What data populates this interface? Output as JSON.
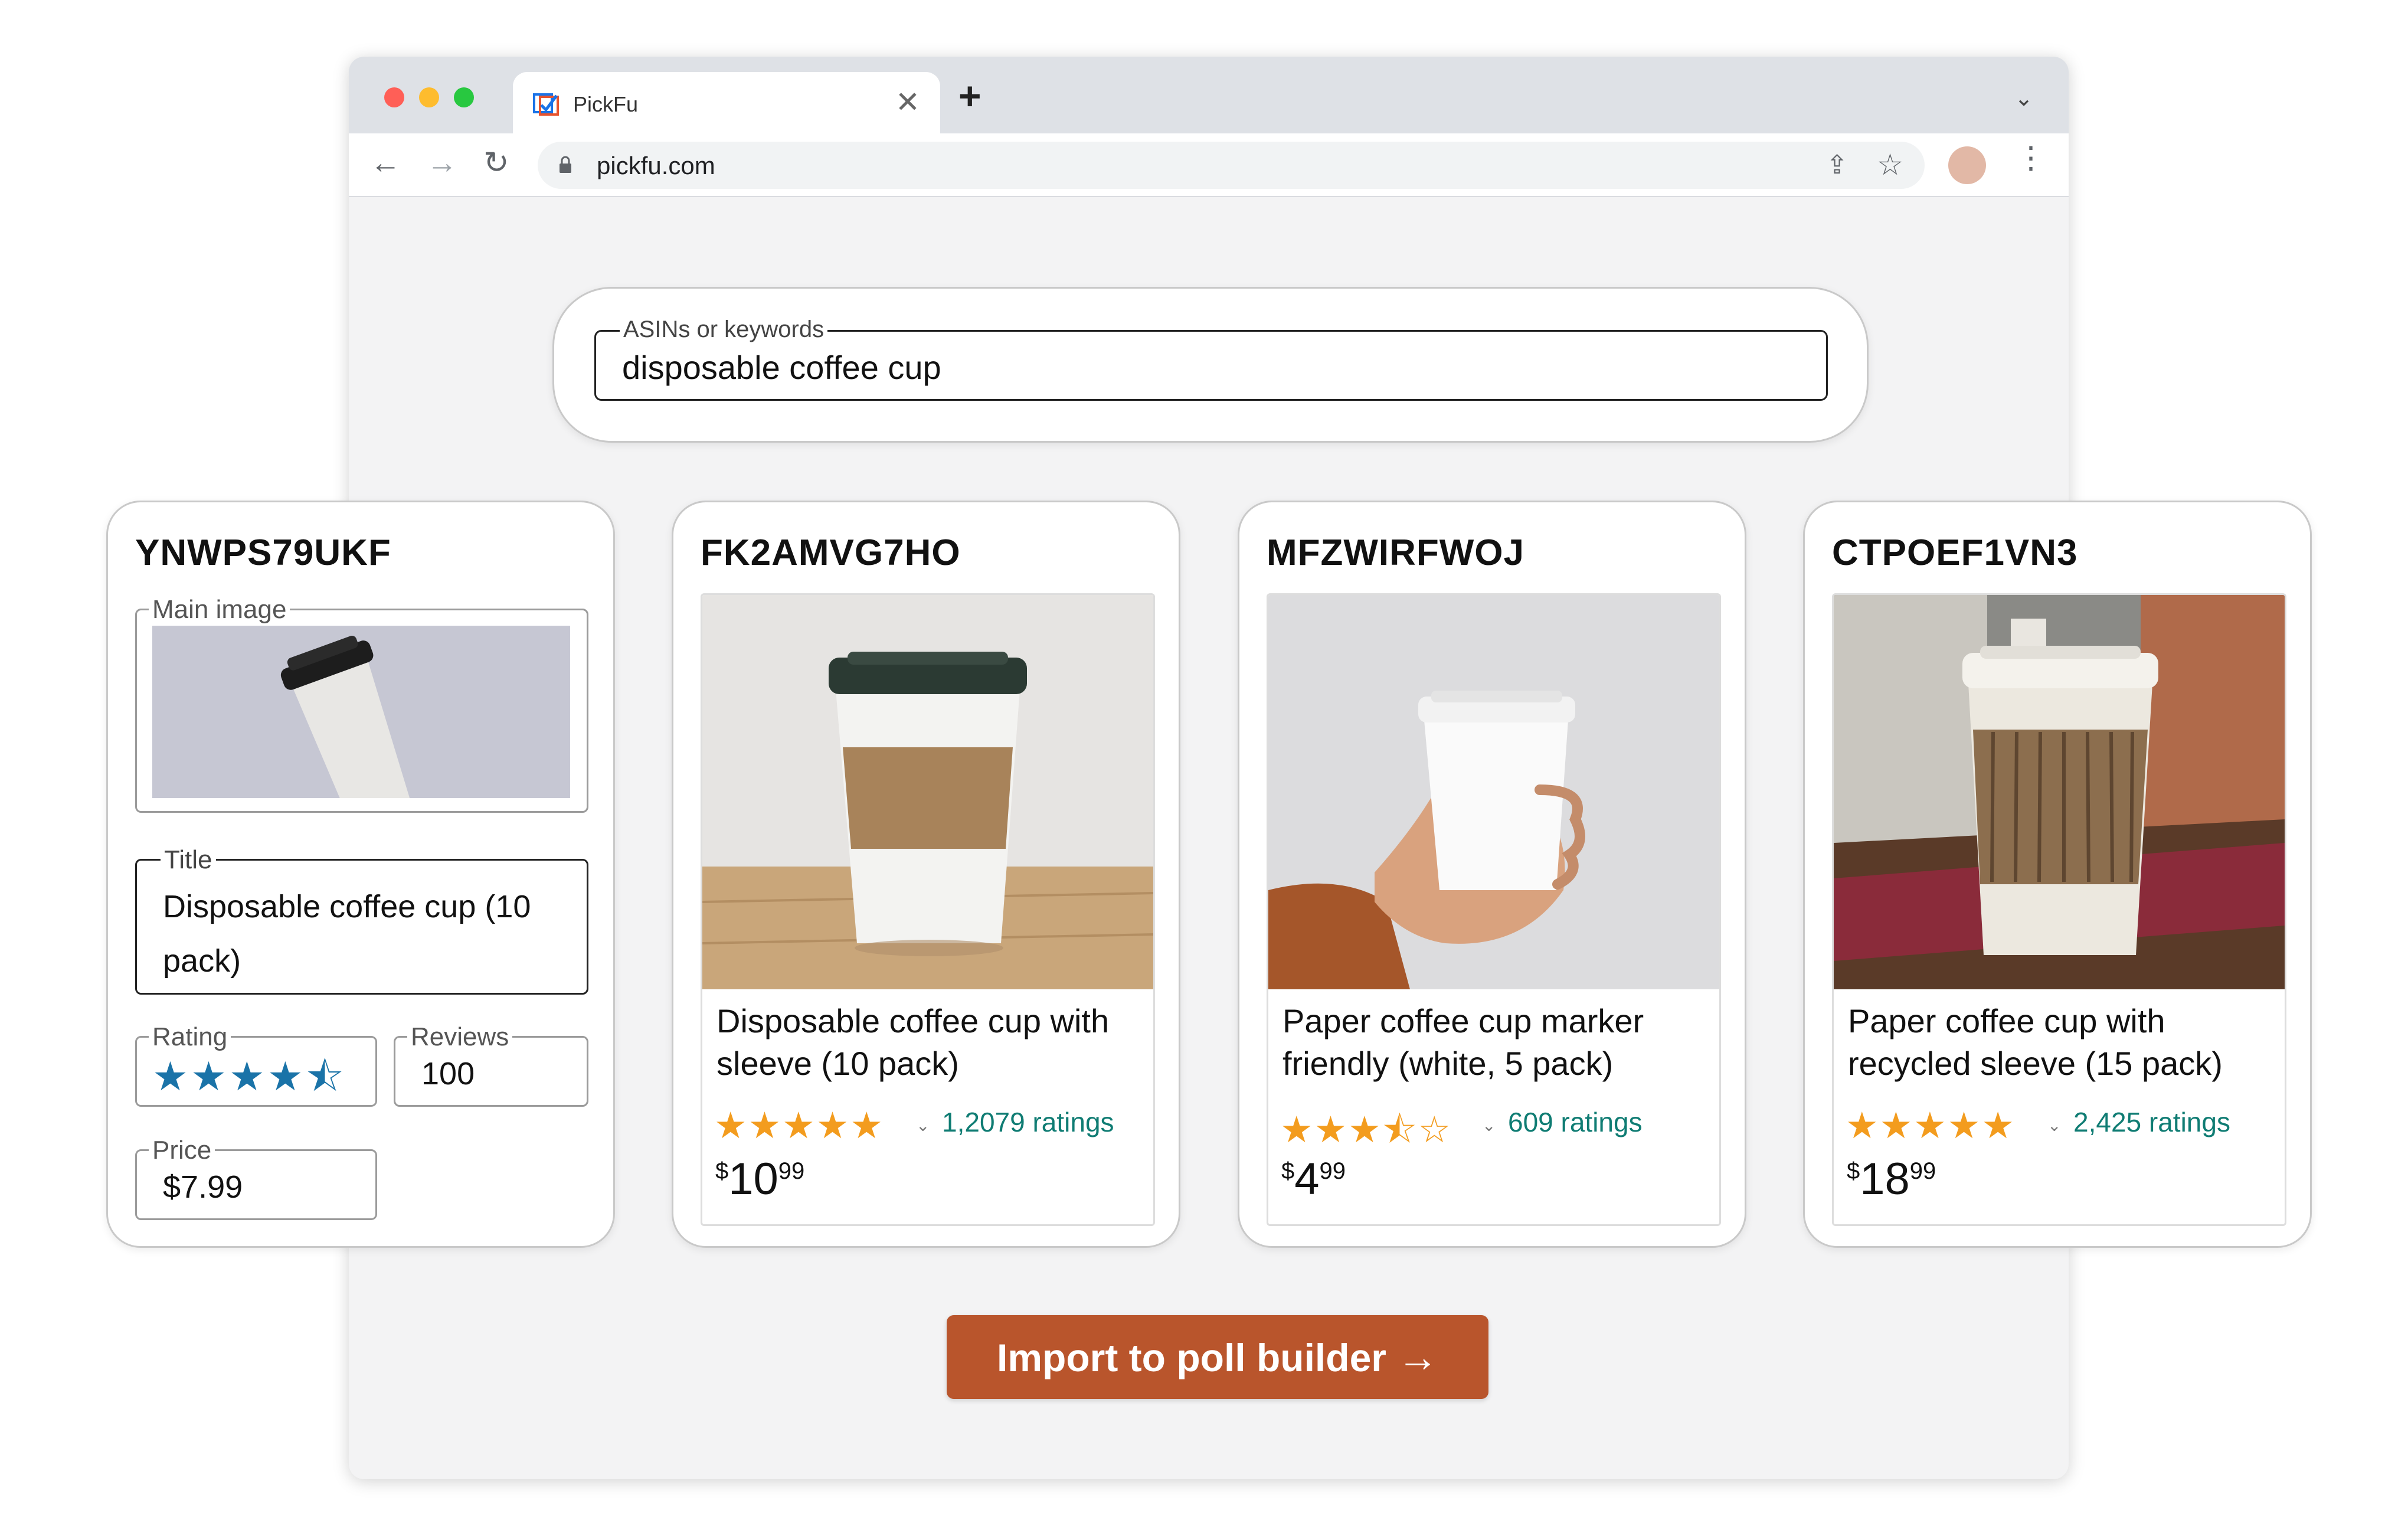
{
  "browser": {
    "tab_title": "PickFu",
    "tab_close": "✕",
    "new_tab": "+",
    "tab_list_caret": "⌄",
    "url": "pickfu.com",
    "back": "←",
    "forward": "→",
    "reload": "↻",
    "share": "⇪",
    "bookmark": "☆",
    "menu": "⋮"
  },
  "search": {
    "label": "ASINs or keywords",
    "value": "disposable coffee cup"
  },
  "editor_card": {
    "asin": "YNWPS79UKF",
    "main_image_label": "Main image",
    "title_label": "Title",
    "title_value": "Disposable coffee cup (10 pack)",
    "rating_label": "Rating",
    "rating_value": 4.5,
    "rating_stars": "★★★★⯪",
    "reviews_label": "Reviews",
    "reviews_value": "100",
    "price_label": "Price",
    "price_value": "$7.99"
  },
  "products": [
    {
      "asin": "FK2AMVG7HO",
      "title": "Disposable coffee cup with sleeve (10 pack)",
      "rating": 5,
      "stars": "★★★★★",
      "ratings_count": "1,2079 ratings",
      "price_currency": "$",
      "price_whole": "10",
      "price_fraction": "99"
    },
    {
      "asin": "MFZWIRFWOJ",
      "title": "Paper coffee cup marker friendly (white, 5 pack)",
      "rating": 3.5,
      "stars": "★★★⯪☆",
      "ratings_count": "609 ratings",
      "price_currency": "$",
      "price_whole": "4",
      "price_fraction": "99"
    },
    {
      "asin": "CTPOEF1VN3",
      "title": "Paper coffee cup with recycled sleeve (15 pack)",
      "rating": 5,
      "stars": "★★★★★",
      "ratings_count": "2,425 ratings",
      "price_currency": "$",
      "price_whole": "18",
      "price_fraction": "99"
    }
  ],
  "dropdown_caret": "⌄",
  "cta": {
    "label": "Import to poll builder",
    "arrow": "→"
  },
  "colors": {
    "cta_bg": "#b9552c",
    "editor_star": "#1a73a8",
    "product_star": "#f39c1e",
    "ratings_link": "#0f7c73"
  }
}
